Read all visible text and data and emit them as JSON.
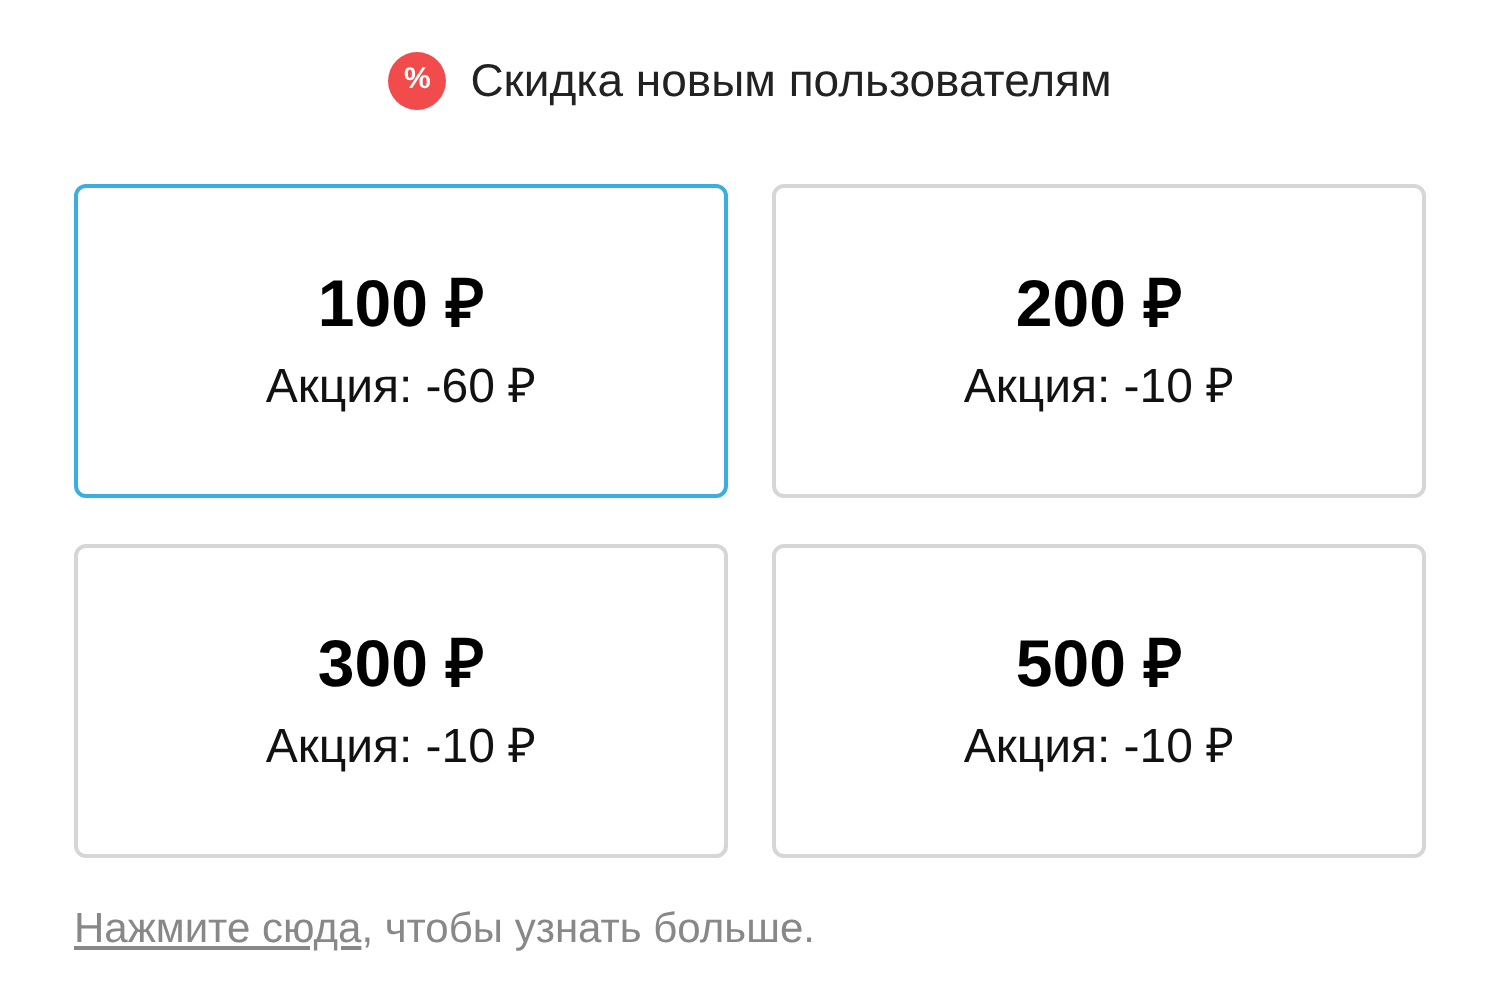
{
  "header": {
    "badge_symbol": "%",
    "title": "Скидка новым пользователям"
  },
  "options": [
    {
      "price": "100 ₽",
      "promo": "Акция: -60 ₽",
      "selected": true
    },
    {
      "price": "200 ₽",
      "promo": "Акция: -10 ₽",
      "selected": false
    },
    {
      "price": "300 ₽",
      "promo": "Акция: -10 ₽",
      "selected": false
    },
    {
      "price": "500 ₽",
      "promo": "Акция: -10 ₽",
      "selected": false
    }
  ],
  "footer": {
    "link": "Нажмите сюда",
    "text": ", чтобы узнать больше."
  }
}
